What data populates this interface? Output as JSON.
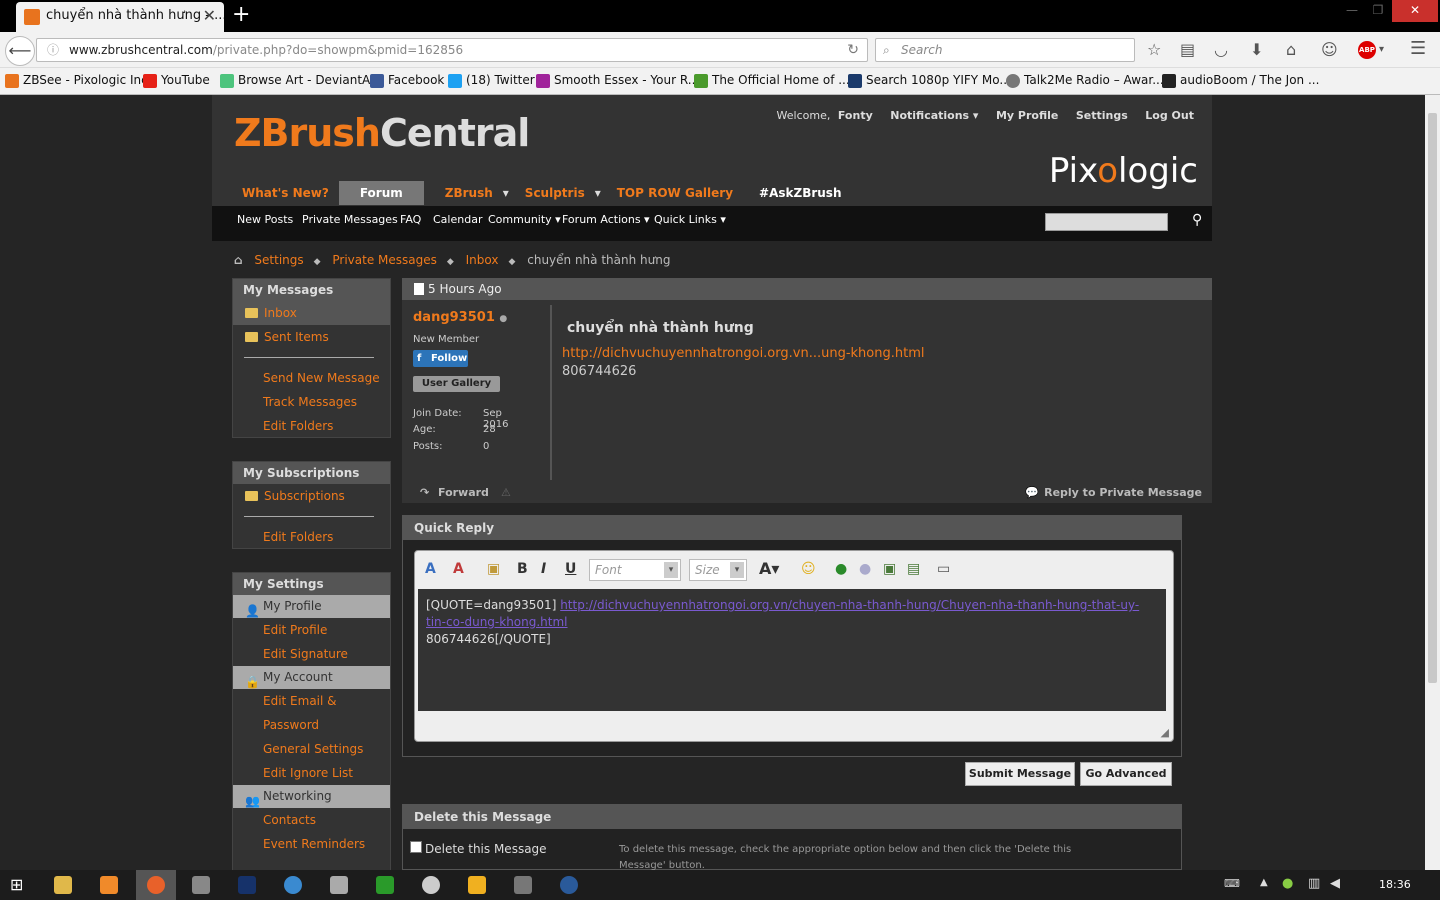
{
  "browser": {
    "tab_title": "chuyển nhà thành hưng - ...",
    "tab_close": "✕",
    "new_tab": "+",
    "url_domain": "www.zbrushcentral.com",
    "url_path": "/private.php?do=showpm&pmid=162856",
    "search_placeholder": "Search",
    "bookmarks": [
      {
        "label": "ZBSee - Pixologic Inc.",
        "color": "#e8731e"
      },
      {
        "label": "YouTube",
        "color": "#e62117"
      },
      {
        "label": "Browse Art - DeviantArt",
        "color": "#4dc47d"
      },
      {
        "label": "Facebook",
        "color": "#3b5998"
      },
      {
        "label": "(18) Twitter",
        "color": "#1da1f2"
      },
      {
        "label": "Smooth Essex - Your R...",
        "color": "#a0249b"
      },
      {
        "label": "The Official Home of ...",
        "color": "#4a9a2c"
      },
      {
        "label": "Search 1080p YIFY Mo...",
        "color": "#1b3a6b"
      },
      {
        "label": "Talk2Me Radio – Awar...",
        "color": "#777777"
      },
      {
        "label": "audioBoom / The Jon ...",
        "color": "#222222"
      }
    ]
  },
  "site": {
    "logo_a": "ZBrush",
    "logo_b": "Central",
    "pixologic_a": "Pix",
    "pixologic_b": "o",
    "pixologic_c": "logic",
    "welcome": "Welcome,",
    "username": "Fonty",
    "top_links": [
      "Notifications ▾",
      "My Profile",
      "Settings",
      "Log Out"
    ],
    "main_nav": [
      "What's New?",
      "Forum",
      "ZBrush",
      "Sculptris",
      "TOP ROW Gallery",
      "#AskZBrush"
    ],
    "sub_nav": [
      "New Posts",
      "Private Messages",
      "FAQ",
      "Calendar",
      "Community ▾",
      "Forum Actions ▾",
      "Quick Links ▾"
    ]
  },
  "breadcrumb": [
    "Settings",
    "Private Messages",
    "Inbox",
    "chuyển nhà thành hưng"
  ],
  "sidebar": {
    "my_messages": "My Messages",
    "inbox": "Inbox",
    "sent_items": "Sent Items",
    "send_new": "Send New Message",
    "track": "Track Messages",
    "edit_folders": "Edit Folders",
    "my_subscriptions": "My Subscriptions",
    "subscriptions": "Subscriptions",
    "edit_folders2": "Edit Folders",
    "my_settings": "My Settings",
    "my_profile": "My Profile",
    "edit_profile": "Edit Profile",
    "edit_signature": "Edit Signature",
    "my_account": "My Account",
    "edit_email": "Edit Email &",
    "password": "Password",
    "general_settings": "General Settings",
    "edit_ignore": "Edit Ignore List",
    "networking": "Networking",
    "contacts": "Contacts",
    "event_reminders": "Event Reminders"
  },
  "message": {
    "time": "5 Hours Ago",
    "author": "dang93501",
    "rank": "New Member",
    "follow": "Follow",
    "user_gallery": "User Gallery",
    "join_label": "Join Date:",
    "join_value": "Sep 2016",
    "age_label": "Age:",
    "age_value": "28",
    "posts_label": "Posts:",
    "posts_value": "0",
    "title": "chuyển nhà thành hưng",
    "link": "http://dichvuchuyennhatrongoi.org.vn...ung-khong.html",
    "body": "806744626",
    "forward": "Forward",
    "reply": "Reply to Private Message"
  },
  "quick_reply": {
    "header": "Quick Reply",
    "font": "Font",
    "size": "Size",
    "quote_open": "[QUOTE=dang93501]",
    "quote_link": "http://dichvuchuyennhatrongoi.org.vn/chuyen-nha-thanh-hung/Chuyen-nha-thanh-hung-that-uy-tin-co-dung-khong.html",
    "quote_body": "806744626[/QUOTE]",
    "submit": "Submit Message",
    "advanced": "Go Advanced"
  },
  "delete": {
    "header": "Delete this Message",
    "checkbox": "Delete this Message",
    "help": "To delete this message, check the appropriate option below and then click the 'Delete this Message' button."
  },
  "taskbar": {
    "time": "18:36"
  }
}
